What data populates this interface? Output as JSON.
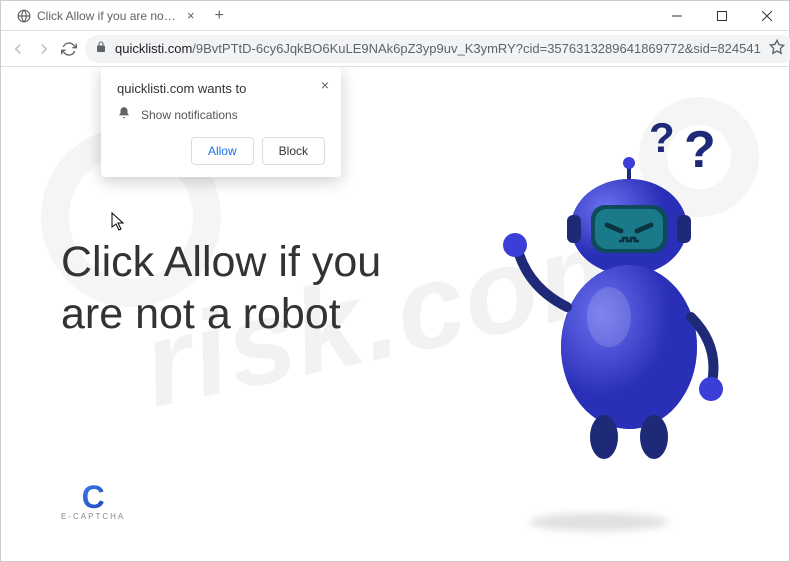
{
  "window": {
    "tab_title": "Click Allow if you are not a robot",
    "new_tab": "+"
  },
  "address": {
    "domain": "quicklisti.com",
    "path": "/9BvtPTtD-6cy6JqkBO6KuLE9NAk6pZ3yp9uv_K3ymRY?cid=3576313289641869772&sid=824541"
  },
  "popup": {
    "title": "quicklisti.com wants to",
    "permission": "Show notifications",
    "allow": "Allow",
    "block": "Block"
  },
  "page": {
    "headline": "Click Allow if you are not a robot",
    "brand_label": "E-CAPTCHA"
  },
  "watermark": {
    "text": "risk.com"
  },
  "colors": {
    "primary_blue": "#1a73e8",
    "robot_blue": "#3b3fd8",
    "robot_dark": "#1e2a78"
  }
}
